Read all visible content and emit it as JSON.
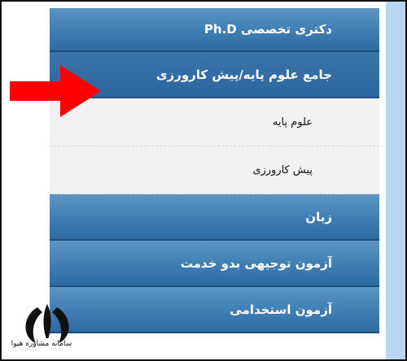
{
  "menu": {
    "items": [
      {
        "label": "دکتری تخصصی Ph.D",
        "type": "blue"
      },
      {
        "label": "جامع علوم پایه/پیش کارورزی",
        "type": "blue-active"
      },
      {
        "label": "علوم پایه",
        "type": "sub"
      },
      {
        "label": "پیش کارورزی",
        "type": "sub"
      },
      {
        "label": "زبان",
        "type": "blue"
      },
      {
        "label": "آزمون توجیهی بدو خدمت",
        "type": "blue"
      },
      {
        "label": "آزمون استخدامی",
        "type": "blue"
      }
    ]
  },
  "watermark": {
    "text": "سامانه مشاوره هیوا"
  },
  "colors": {
    "menu_blue": "#3f7db3",
    "sub_bg": "#f2f2f2",
    "arrow_red": "#ff0000",
    "side_panel": "#b8d6ef"
  }
}
